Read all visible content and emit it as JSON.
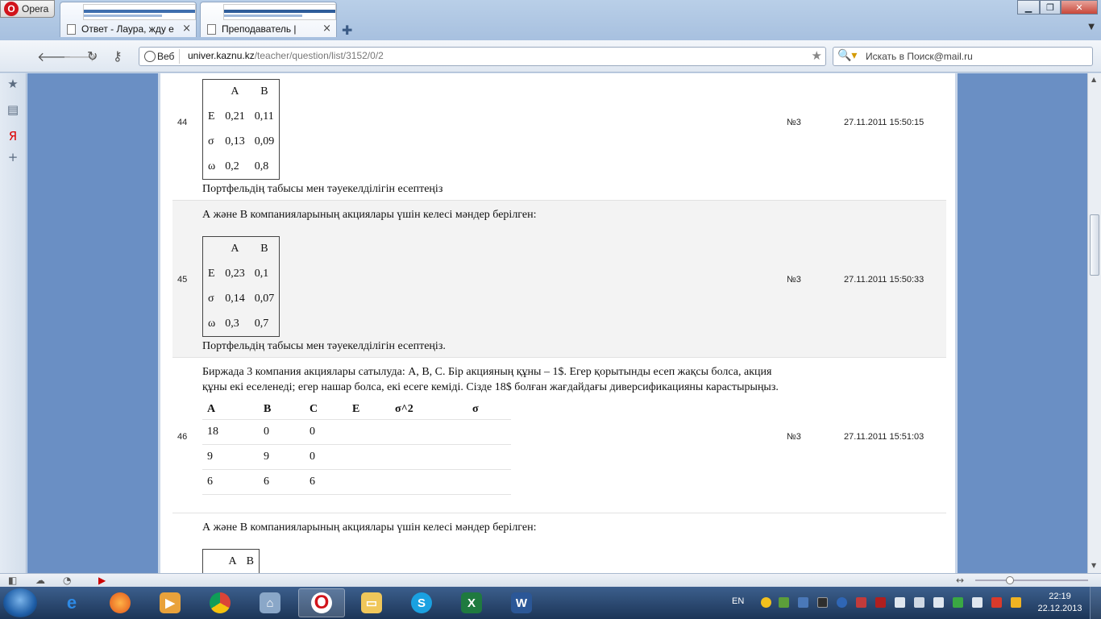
{
  "browser": {
    "menu_label": "Opera",
    "tabs": [
      {
        "label": "Ответ - Лаура, жду е..."
      },
      {
        "label": "Преподаватель |"
      }
    ],
    "address": {
      "badge": "Веб",
      "url_host": "univer.kaznu.kz",
      "url_path": "/teacher/question/list/3152/0/2"
    },
    "search_placeholder": "Искать в Поиск@mail.ru"
  },
  "rows": [
    {
      "num": "44",
      "code": "№3",
      "date": "27.11.2011 15:50:15",
      "table": {
        "header": [
          "A",
          "B"
        ],
        "rows": [
          [
            "E",
            "0,21",
            "0,11"
          ],
          [
            "σ",
            "0,13",
            "0,09"
          ],
          [
            "ω",
            "0,2",
            "0,8"
          ]
        ]
      },
      "footer": "Портфельдің табысы мен тәуекелділігін есептеңіз"
    },
    {
      "num": "45",
      "code": "№3",
      "date": "27.11.2011 15:50:33",
      "intro": "А және В компанияларының акциялары үшін келесі мәндер берілген:",
      "table": {
        "header": [
          "A",
          "B"
        ],
        "rows": [
          [
            "E",
            "0,23",
            "0,1"
          ],
          [
            "σ",
            "0,14",
            "0,07"
          ],
          [
            "ω",
            "0,3",
            "0,7"
          ]
        ]
      },
      "footer": "Портфельдің табысы мен тәуекелділігін есептеңіз."
    },
    {
      "num": "46",
      "code": "№3",
      "date": "27.11.2011 15:51:03",
      "intro": "Биржада 3 компания акциялары сатылуда: А, В, С. Бір акцияның құны – 1$. Егер қорытынды есеп жақсы болса, акция құны екі еселенеді; егер нашар болса, екі есеге кеміді. Сізде 18$ болған жағдайдағы диверсификацияны карастырыңыз.",
      "table": {
        "header": [
          "A",
          "B",
          "C",
          "E",
          "σ^2",
          "σ"
        ],
        "rows": [
          [
            "18",
            "0",
            "0",
            "",
            "",
            ""
          ],
          [
            "9",
            "9",
            "0",
            "",
            "",
            ""
          ],
          [
            "6",
            "6",
            "6",
            "",
            "",
            ""
          ]
        ]
      }
    },
    {
      "intro": "А және В компанияларының акциялары үшін келесі мәндер берілген:",
      "table": {
        "header": [
          "A",
          "B"
        ]
      }
    }
  ],
  "taskbar": {
    "lang": "EN",
    "time": "22:19",
    "date": "22.12.2013"
  }
}
